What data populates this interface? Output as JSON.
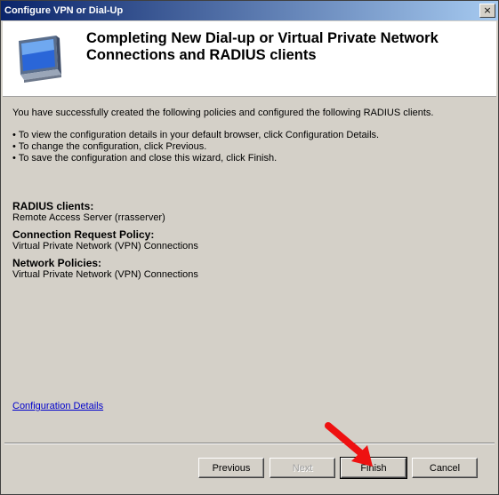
{
  "window": {
    "title": "Configure VPN or Dial-Up",
    "close_glyph": "×"
  },
  "header": {
    "title": "Completing New Dial-up or Virtual Private Network Connections and RADIUS clients",
    "icon": "computer-monitor-icon"
  },
  "intro": "You have successfully created the following policies and configured the following RADIUS clients.",
  "bullets": [
    "• To view the configuration details in your default browser, click Configuration Details.",
    "• To change the configuration, click Previous.",
    "• To save the configuration and close this wizard, click Finish."
  ],
  "sections": {
    "radius": {
      "heading": "RADIUS clients:",
      "value": "Remote Access Server (rrasserver)"
    },
    "connection": {
      "heading": "Connection Request Policy:",
      "value": "Virtual Private Network (VPN) Connections"
    },
    "network": {
      "heading": "Network Policies:",
      "value": "Virtual Private Network (VPN) Connections"
    }
  },
  "link": "Configuration Details",
  "buttons": {
    "previous": "Previous",
    "next": "Next",
    "finish": "Finish",
    "cancel": "Cancel"
  },
  "annotation": {
    "icon": "red-arrow-icon",
    "color": "#ee1111"
  }
}
